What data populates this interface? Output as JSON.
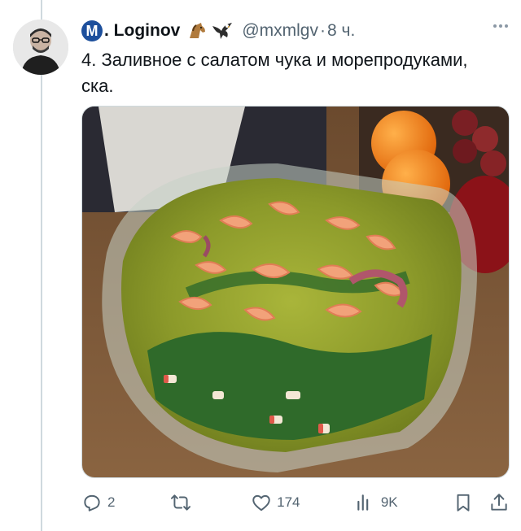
{
  "tweet": {
    "avatar_alt": "avatar",
    "badge_letter": "M",
    "display_name": ". Loginov",
    "handle": "@mxmlgv",
    "separator": "·",
    "time": "8 ч.",
    "text": "4. Заливное с салатом чука и морепродуками, ска.",
    "media_description": "photo",
    "accent_color": "#1d9bf0",
    "icons": {
      "emoji_1": "horse-icon",
      "emoji_2": "eagle-icon",
      "more": "more-icon"
    }
  },
  "actions": {
    "reply_count": "2",
    "retweet_count": "",
    "like_count": "174",
    "views_count": "9K",
    "icons": {
      "reply": "reply-icon",
      "retweet": "retweet-icon",
      "like": "heart-icon",
      "views": "views-icon",
      "bookmark": "bookmark-icon",
      "share": "share-icon"
    }
  }
}
